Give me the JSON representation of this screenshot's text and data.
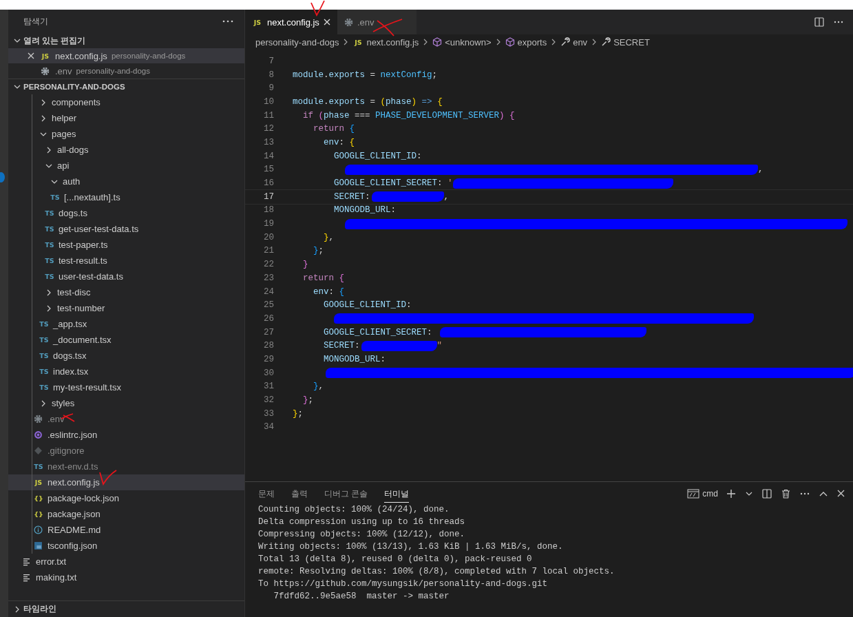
{
  "sidebar": {
    "title": "탐색기",
    "open_editors": {
      "title": "열려 있는 편집기",
      "expanded": true,
      "items": [
        {
          "name": "next.config.js",
          "description": "personality-and-dogs",
          "kind": "js",
          "icon_label": "JS",
          "selected": true
        },
        {
          "name": ".env",
          "description": "personality-and-dogs",
          "kind": "env",
          "selected": false
        }
      ]
    },
    "project": {
      "title": "PERSONALITY-AND-DOGS",
      "expanded": true,
      "items": [
        {
          "name": "components",
          "kind": "folder",
          "expanded": false,
          "selected": false
        },
        {
          "name": "helper",
          "kind": "folder",
          "expanded": false,
          "selected": false
        },
        {
          "name": "pages",
          "kind": "folder",
          "expanded": true,
          "selected": false,
          "children": [
            {
              "name": "all-dogs",
              "kind": "folder",
              "expanded": false,
              "selected": false
            },
            {
              "name": "api",
              "kind": "folder",
              "expanded": true,
              "selected": false,
              "children": [
                {
                  "name": "auth",
                  "kind": "folder",
                  "expanded": true,
                  "selected": false,
                  "children": [
                    {
                      "name": "[...nextauth].ts",
                      "kind": "ts",
                      "icon_label": "TS",
                      "selected": false,
                      "ignored": false
                    }
                  ]
                },
                {
                  "name": "dogs.ts",
                  "kind": "ts",
                  "icon_label": "TS",
                  "selected": false,
                  "ignored": false
                },
                {
                  "name": "get-user-test-data.ts",
                  "kind": "ts",
                  "icon_label": "TS",
                  "selected": false,
                  "ignored": false
                },
                {
                  "name": "test-paper.ts",
                  "kind": "ts",
                  "icon_label": "TS",
                  "selected": false,
                  "ignored": false
                },
                {
                  "name": "test-result.ts",
                  "kind": "ts",
                  "icon_label": "TS",
                  "selected": false,
                  "ignored": false
                },
                {
                  "name": "user-test-data.ts",
                  "kind": "ts",
                  "icon_label": "TS",
                  "selected": false,
                  "ignored": false
                }
              ]
            },
            {
              "name": "test-disc",
              "kind": "folder",
              "expanded": false,
              "selected": false
            },
            {
              "name": "test-number",
              "kind": "folder",
              "expanded": false,
              "selected": false
            },
            {
              "name": "_app.tsx",
              "kind": "ts",
              "icon_label": "TS",
              "selected": false,
              "ignored": false
            },
            {
              "name": "_document.tsx",
              "kind": "ts",
              "icon_label": "TS",
              "selected": false,
              "ignored": false
            },
            {
              "name": "dogs.tsx",
              "kind": "ts",
              "icon_label": "TS",
              "selected": false,
              "ignored": false
            },
            {
              "name": "index.tsx",
              "kind": "ts",
              "icon_label": "TS",
              "selected": false,
              "ignored": false
            },
            {
              "name": "my-test-result.tsx",
              "kind": "ts",
              "icon_label": "TS",
              "selected": false,
              "ignored": false
            }
          ]
        },
        {
          "name": "styles",
          "kind": "folder",
          "expanded": false,
          "selected": false
        },
        {
          "name": ".env",
          "kind": "env",
          "selected": false,
          "ignored": true
        },
        {
          "name": ".eslintrc.json",
          "kind": "eslint",
          "selected": false,
          "ignored": false
        },
        {
          "name": ".gitignore",
          "kind": "git",
          "selected": false,
          "ignored": true
        },
        {
          "name": "next-env.d.ts",
          "kind": "ts",
          "icon_label": "TS",
          "selected": false,
          "ignored": true
        },
        {
          "name": "next.config.js",
          "kind": "js",
          "icon_label": "JS",
          "selected": true,
          "ignored": false
        },
        {
          "name": "package-lock.json",
          "kind": "json",
          "icon_label": "{}",
          "selected": false,
          "ignored": false
        },
        {
          "name": "package.json",
          "kind": "json",
          "icon_label": "{}",
          "selected": false,
          "ignored": false
        },
        {
          "name": "README.md",
          "kind": "readme",
          "selected": false,
          "ignored": false
        },
        {
          "name": "tsconfig.json",
          "kind": "tsconfig",
          "selected": false,
          "ignored": false
        }
      ],
      "outer_files": [
        {
          "name": "error.txt",
          "kind": "text",
          "selected": false,
          "ignored": false
        },
        {
          "name": "making.txt",
          "kind": "text",
          "selected": false,
          "ignored": false
        }
      ]
    },
    "timeline": {
      "title": "타임라인",
      "expanded": false
    }
  },
  "editor": {
    "tabs": [
      {
        "label": "next.config.js",
        "kind": "js",
        "icon_label": "JS",
        "selected": true
      },
      {
        "label": ".env",
        "kind": "env",
        "selected": false
      }
    ],
    "breadcrumbs": [
      {
        "label": "personality-and-dogs",
        "kind": "folder"
      },
      {
        "label": "next.config.js",
        "kind": "js",
        "icon_label": "JS"
      },
      {
        "label": "<unknown>",
        "kind": "module"
      },
      {
        "label": "exports",
        "kind": "module"
      },
      {
        "label": "env",
        "kind": "property"
      },
      {
        "label": "SECRET",
        "kind": "property"
      }
    ],
    "lines": [
      {
        "number": "7",
        "current": false
      },
      {
        "number": "8",
        "current": false,
        "tokens": [
          {
            "text": "module",
            "kind": "var"
          },
          {
            "text": ".",
            "kind": "p"
          },
          {
            "text": "exports",
            "kind": "var"
          },
          {
            "text": " = ",
            "kind": "p"
          },
          {
            "text": "nextConfig",
            "kind": "const"
          },
          {
            "text": ";",
            "kind": "p"
          }
        ]
      },
      {
        "number": "9",
        "current": false
      },
      {
        "number": "10",
        "current": false,
        "tokens": [
          {
            "text": "module",
            "kind": "var"
          },
          {
            "text": ".",
            "kind": "p"
          },
          {
            "text": "exports",
            "kind": "var"
          },
          {
            "text": " = ",
            "kind": "p"
          },
          {
            "text": "(",
            "kind": "b1"
          },
          {
            "text": "phase",
            "kind": "var"
          },
          {
            "text": ") ",
            "kind": "b1"
          },
          {
            "text": "=> ",
            "kind": "op"
          },
          {
            "text": "{",
            "kind": "b1"
          }
        ]
      },
      {
        "number": "11",
        "current": false,
        "tokens": [
          {
            "text": "  if ",
            "kind": "kw"
          },
          {
            "text": "(",
            "kind": "b2"
          },
          {
            "text": "phase",
            "kind": "var"
          },
          {
            "text": " === ",
            "kind": "p"
          },
          {
            "text": "PHASE_DEVELOPMENT_SERVER",
            "kind": "const"
          },
          {
            "text": ") {",
            "kind": "b2"
          }
        ]
      },
      {
        "number": "12",
        "current": false,
        "tokens": [
          {
            "text": "    return ",
            "kind": "kw"
          },
          {
            "text": "{",
            "kind": "b3"
          }
        ]
      },
      {
        "number": "13",
        "current": false,
        "tokens": [
          {
            "text": "      env",
            "kind": "var"
          },
          {
            "text": ": ",
            "kind": "p"
          },
          {
            "text": "{",
            "kind": "b1"
          }
        ]
      },
      {
        "number": "14",
        "current": false,
        "tokens": [
          {
            "text": "        GOOGLE_CLIENT_ID",
            "kind": "var"
          },
          {
            "text": ":",
            "kind": "p"
          }
        ]
      },
      {
        "number": "15",
        "current": false,
        "tokens": [
          {
            "kind": "redacted"
          },
          {
            "text": ",",
            "kind": "p"
          }
        ]
      },
      {
        "number": "16",
        "current": false,
        "tokens": [
          {
            "text": "        GOOGLE_CLIENT_SECRET",
            "kind": "var"
          },
          {
            "text": ": ",
            "kind": "p"
          },
          {
            "text": "'",
            "kind": "str"
          },
          {
            "kind": "redacted"
          }
        ]
      },
      {
        "number": "17",
        "current": true,
        "tokens": [
          {
            "text": "        SECRET",
            "kind": "var"
          },
          {
            "text": ":",
            "kind": "p"
          },
          {
            "kind": "redacted"
          },
          {
            "text": ",",
            "kind": "p"
          }
        ]
      },
      {
        "number": "18",
        "current": false,
        "tokens": [
          {
            "text": "        MONGODB_URL",
            "kind": "var"
          },
          {
            "text": ":",
            "kind": "p"
          }
        ]
      },
      {
        "number": "19",
        "current": false,
        "tokens": [
          {
            "kind": "redacted"
          }
        ]
      },
      {
        "number": "20",
        "current": false,
        "tokens": [
          {
            "text": "      }",
            "kind": "b1"
          },
          {
            "text": ",",
            "kind": "p"
          }
        ]
      },
      {
        "number": "21",
        "current": false,
        "tokens": [
          {
            "text": "    }",
            "kind": "b3"
          },
          {
            "text": ";",
            "kind": "p"
          }
        ]
      },
      {
        "number": "22",
        "current": false,
        "tokens": [
          {
            "text": "  }",
            "kind": "b2"
          }
        ]
      },
      {
        "number": "23",
        "current": false,
        "tokens": [
          {
            "text": "  return ",
            "kind": "kw"
          },
          {
            "text": "{",
            "kind": "b2"
          }
        ]
      },
      {
        "number": "24",
        "current": false,
        "tokens": [
          {
            "text": "    env",
            "kind": "var"
          },
          {
            "text": ": ",
            "kind": "p"
          },
          {
            "text": "{",
            "kind": "b3"
          }
        ]
      },
      {
        "number": "25",
        "current": false,
        "tokens": [
          {
            "text": "      GOOGLE_CLIENT_ID",
            "kind": "var"
          },
          {
            "text": ":",
            "kind": "p"
          }
        ]
      },
      {
        "number": "26",
        "current": false,
        "tokens": [
          {
            "kind": "redacted"
          }
        ]
      },
      {
        "number": "27",
        "current": false,
        "tokens": [
          {
            "text": "      GOOGLE_CLIENT_SECRET",
            "kind": "var"
          },
          {
            "text": ": ",
            "kind": "p"
          },
          {
            "kind": "redacted"
          }
        ]
      },
      {
        "number": "28",
        "current": false,
        "tokens": [
          {
            "text": "      SECRET",
            "kind": "var"
          },
          {
            "text": ":",
            "kind": "p"
          },
          {
            "kind": "redacted"
          },
          {
            "text": "\"",
            "kind": "str"
          }
        ]
      },
      {
        "number": "29",
        "current": false,
        "tokens": [
          {
            "text": "      MONGODB_URL",
            "kind": "var"
          },
          {
            "text": ":",
            "kind": "p"
          }
        ]
      },
      {
        "number": "30",
        "current": false,
        "tokens": [
          {
            "kind": "redacted"
          }
        ]
      },
      {
        "number": "31",
        "current": false,
        "tokens": [
          {
            "text": "    }",
            "kind": "b3"
          },
          {
            "text": ",",
            "kind": "p"
          }
        ]
      },
      {
        "number": "32",
        "current": false,
        "tokens": [
          {
            "text": "  }",
            "kind": "b2"
          },
          {
            "text": ";",
            "kind": "p"
          }
        ]
      },
      {
        "number": "33",
        "current": false,
        "tokens": [
          {
            "text": "}",
            "kind": "b1"
          },
          {
            "text": ";",
            "kind": "p"
          }
        ]
      },
      {
        "number": "34",
        "current": false
      }
    ]
  },
  "panel": {
    "tabs": [
      {
        "label": "문제",
        "selected": false
      },
      {
        "label": "출력",
        "selected": false
      },
      {
        "label": "디버그 콘솔",
        "selected": false
      },
      {
        "label": "터미널",
        "selected": true
      }
    ],
    "shell": "cmd",
    "terminal_lines": [
      "Counting objects: 100% (24/24), done.",
      "Delta compression using up to 16 threads",
      "Compressing objects: 100% (12/12), done.",
      "Writing objects: 100% (13/13), 1.63 KiB | 1.63 MiB/s, done.",
      "Total 13 (delta 8), reused 0 (delta 0), pack-reused 0",
      "remote: Resolving deltas: 100% (8/8), completed with 7 local objects.",
      "To https://github.com/mysungsik/personality-and-dogs.git",
      "   7fdfd62..9e5ae58  master -> master"
    ]
  }
}
